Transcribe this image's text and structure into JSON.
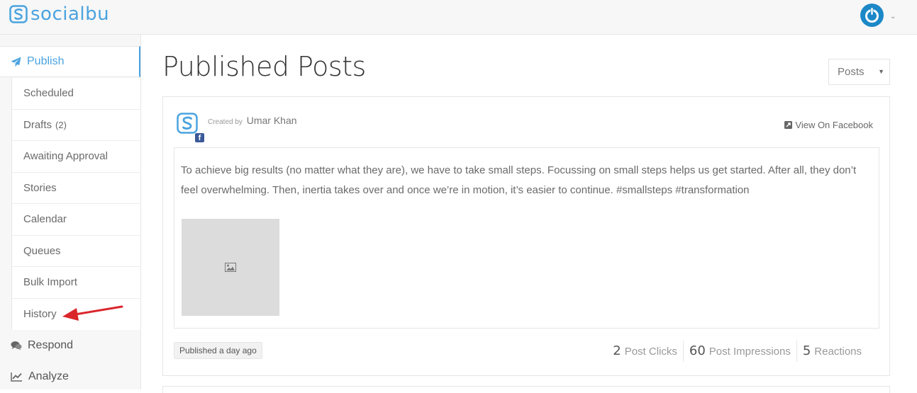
{
  "app": {
    "name": "socialbu"
  },
  "colors": {
    "brand": "#4aa3df",
    "active_border": "#4aa3df",
    "facebook": "#3b5998",
    "annotation_arrow": "#d9262b"
  },
  "header": {
    "user_icon": "power-icon"
  },
  "sidebar": {
    "publish": {
      "label": "Publish",
      "icon": "paper-plane-icon"
    },
    "subitems": [
      {
        "label": "Scheduled",
        "count": ""
      },
      {
        "label": "Drafts",
        "count": "(2)"
      },
      {
        "label": "Awaiting Approval",
        "count": ""
      },
      {
        "label": "Stories",
        "count": ""
      },
      {
        "label": "Calendar",
        "count": ""
      },
      {
        "label": "Queues",
        "count": ""
      },
      {
        "label": "Bulk Import",
        "count": ""
      },
      {
        "label": "History",
        "count": ""
      }
    ],
    "respond": {
      "label": "Respond",
      "icon": "comments-icon"
    },
    "analyze": {
      "label": "Analyze",
      "icon": "line-chart-icon"
    }
  },
  "main": {
    "title": "Published Posts",
    "filter_select": {
      "value": "Posts"
    },
    "post": {
      "created_by_label": "Created by",
      "author": "Umar Khan",
      "network_icon": "facebook-icon",
      "view_link": "View On Facebook",
      "text": "To achieve big results (no matter what they are), we have to take small steps. Focussing on small steps helps us get started. After all, they don’t feel overwhelming. Then, inertia takes over and once we’re in motion, it’s easier to continue. #smallsteps #transformation",
      "published": "Published a day ago",
      "stats": [
        {
          "value": "2",
          "label": "Post Clicks"
        },
        {
          "value": "60",
          "label": "Post Impressions"
        },
        {
          "value": "5",
          "label": "Reactions"
        }
      ]
    }
  }
}
